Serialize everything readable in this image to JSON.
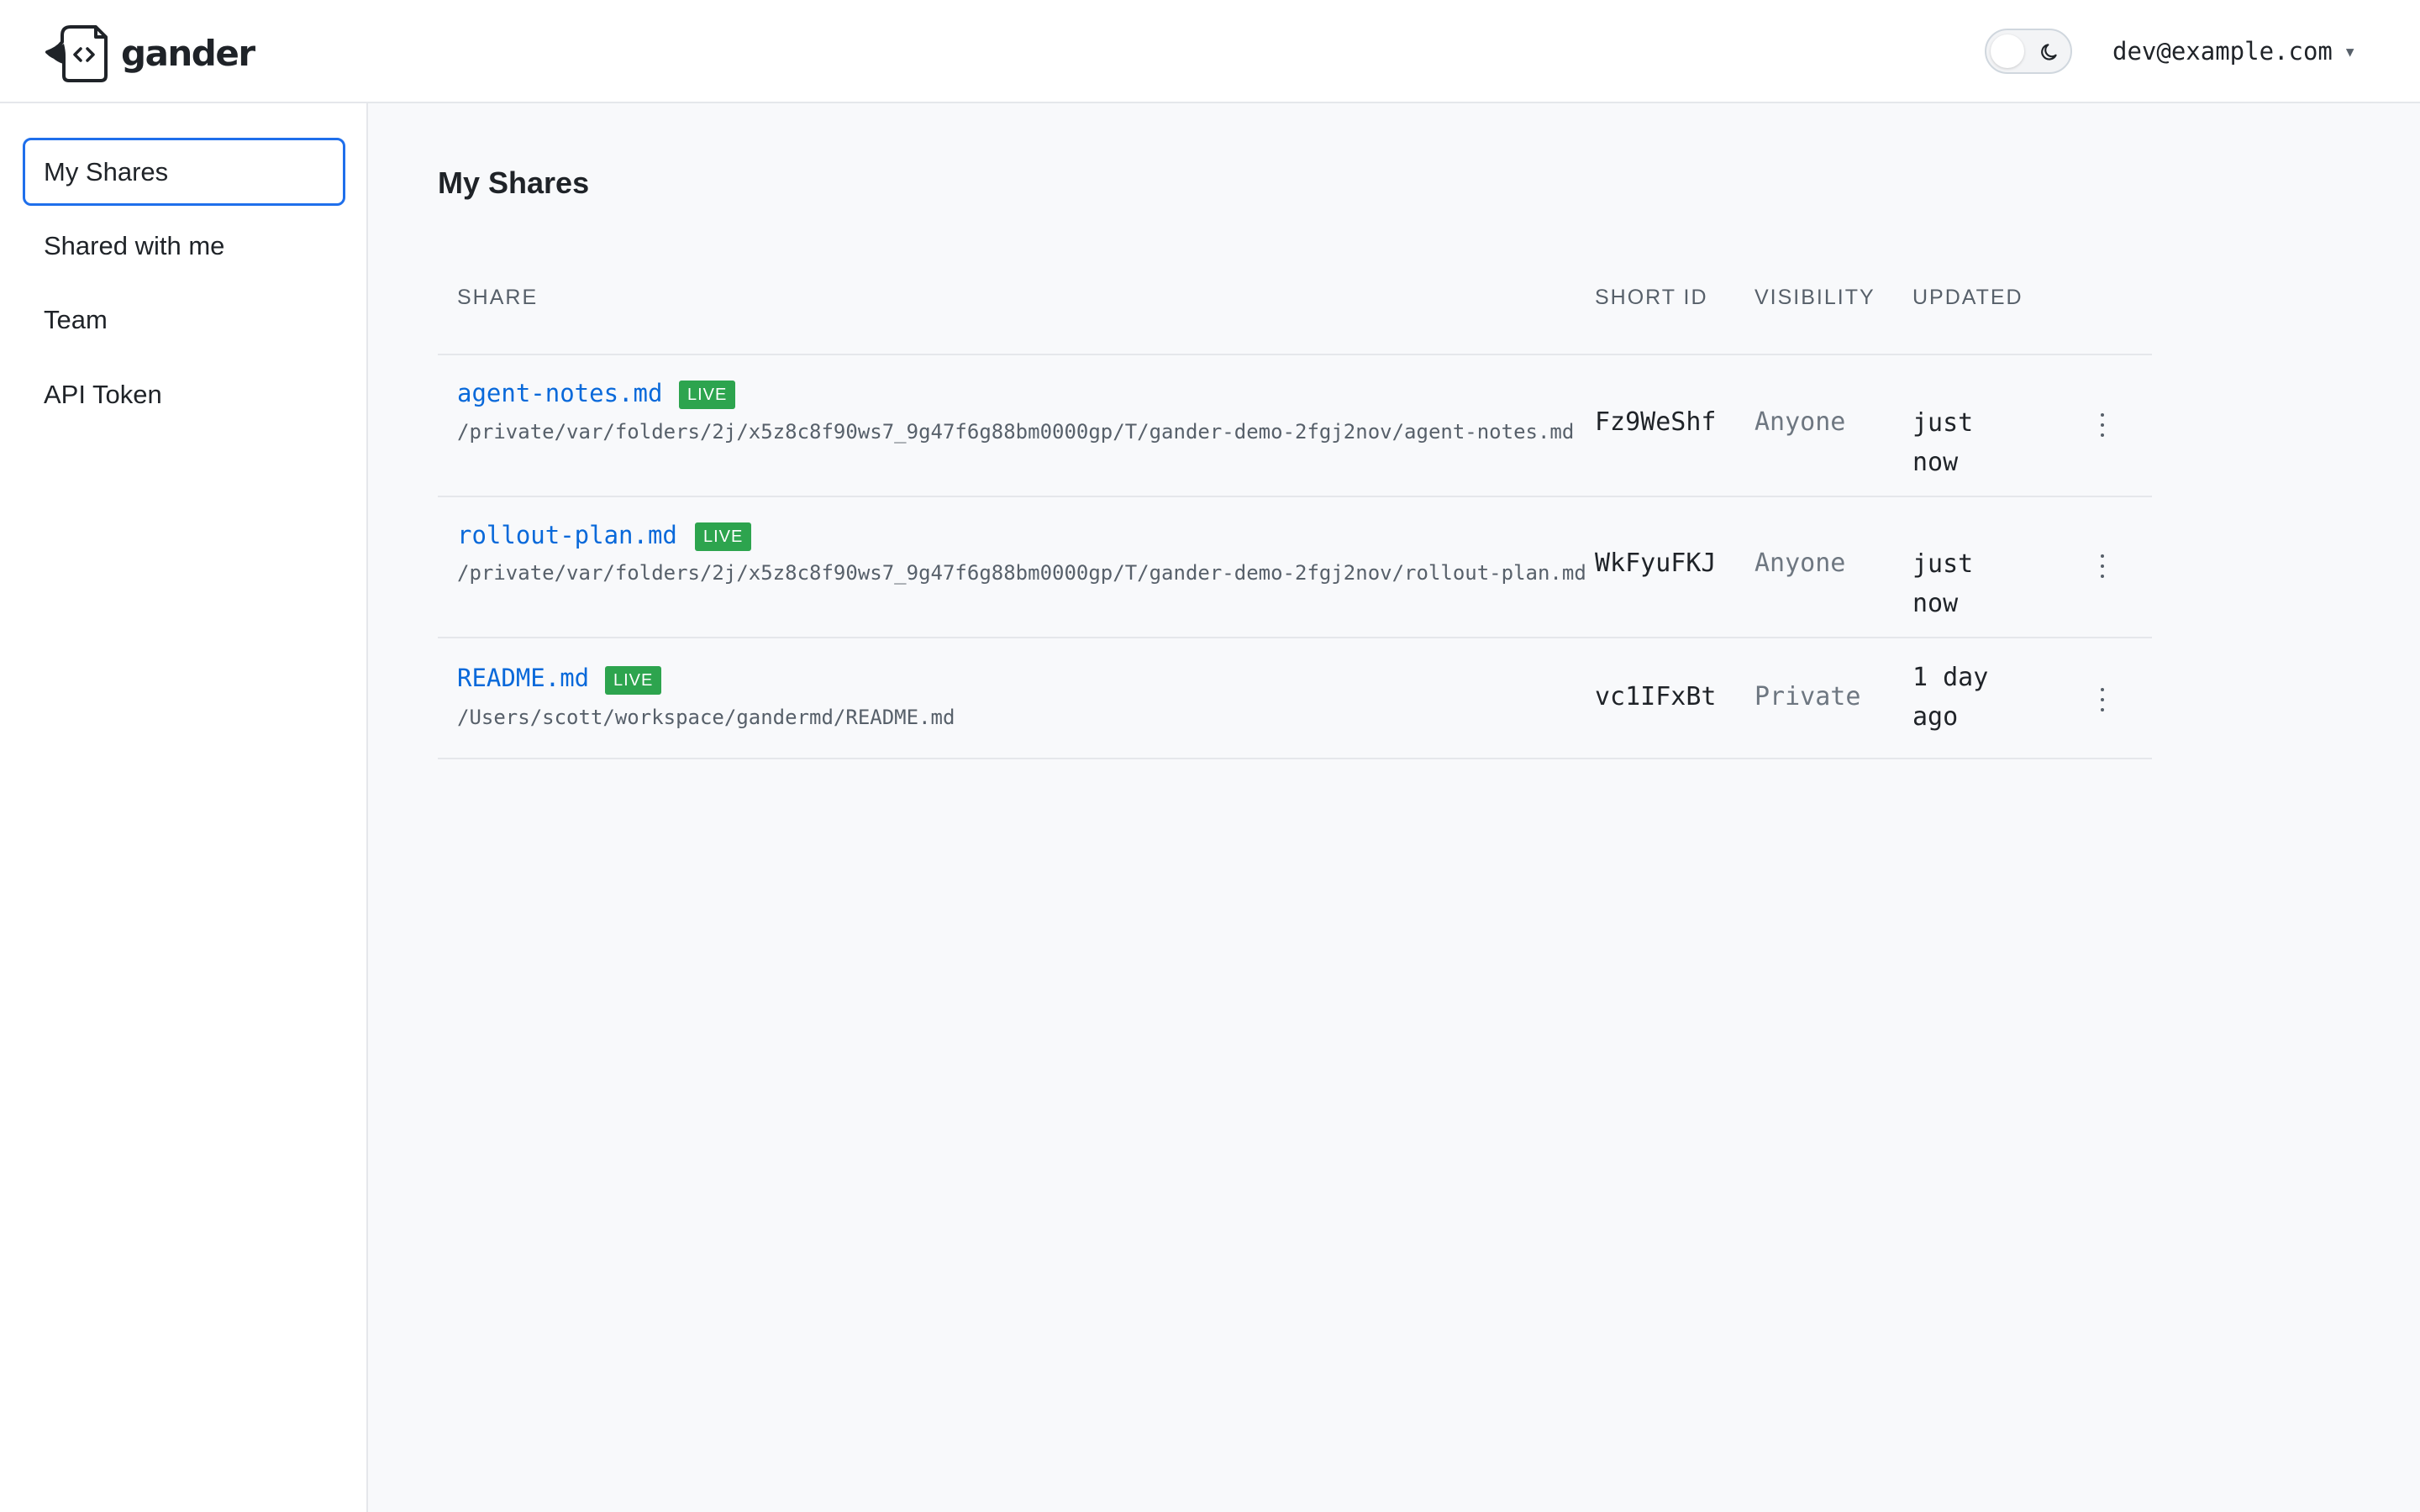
{
  "app": {
    "brand": "gander",
    "user_email": "dev@example.com",
    "icons": {
      "logo": "gander-logo-icon",
      "theme": "moon-icon",
      "menu": "chevron-down-icon",
      "row_menu": "kebab-menu-icon"
    },
    "colors": {
      "accent": "#1f6feb",
      "link": "#0969da",
      "live_badge": "#2da44e",
      "muted": "#57606a",
      "background": "#f8f9fb"
    }
  },
  "sidebar": {
    "items": [
      {
        "label": "My Shares",
        "active": true
      },
      {
        "label": "Shared with me",
        "active": false
      },
      {
        "label": "Team",
        "active": false
      },
      {
        "label": "API Token",
        "active": false
      }
    ]
  },
  "main": {
    "title": "My Shares",
    "table": {
      "headers": [
        "SHARE",
        "SHORT ID",
        "VISIBILITY",
        "UPDATED"
      ],
      "rows": [
        {
          "name": "agent-notes.md",
          "badge": "LIVE",
          "path": "/private/var/folders/2j/x5z8c8f90ws7_9g47f6g88bm0000gp/T/gander-demo-2fgj2nov/agent-notes.md",
          "short_id": "Fz9WeShf",
          "visibility": "Anyone",
          "updated": "just now"
        },
        {
          "name": "rollout-plan.md",
          "badge": "LIVE",
          "path": "/private/var/folders/2j/x5z8c8f90ws7_9g47f6g88bm0000gp/T/gander-demo-2fgj2nov/rollout-plan.md",
          "short_id": "WkFyuFKJ",
          "visibility": "Anyone",
          "updated": "just now"
        },
        {
          "name": "README.md",
          "badge": "LIVE",
          "path": "/Users/scott/workspace/gandermd/README.md",
          "short_id": "vc1IFxBt",
          "visibility": "Private",
          "updated": "1 day ago"
        }
      ]
    }
  }
}
